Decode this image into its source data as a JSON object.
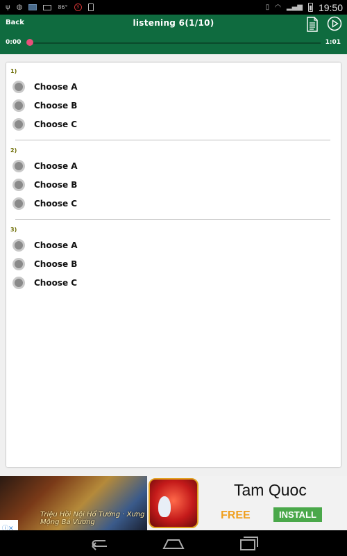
{
  "status_bar": {
    "temperature": "86°",
    "notification_count": "3",
    "time": "19:50"
  },
  "header": {
    "back_label": "Back",
    "title": "listening 6(1/10)",
    "time_current": "0:00",
    "time_total": "1:01",
    "progress_fraction": 0.0,
    "accent_color": "#0f6b3f",
    "seek_color": "#e8507a"
  },
  "questions": [
    {
      "number": "1)",
      "options": [
        "Choose A",
        "Choose B",
        "Choose C"
      ]
    },
    {
      "number": "2)",
      "options": [
        "Choose A",
        "Choose B",
        "Choose C"
      ]
    },
    {
      "number": "3)",
      "options": [
        "Choose A",
        "Choose B",
        "Choose C"
      ]
    }
  ],
  "ad": {
    "title": "Tam Quoc",
    "free_label": "FREE",
    "install_label": "INSTALL",
    "image_caption": "Triệu Hồi Nội Hổ Tướng · Xưng Mộng Bá Vương"
  },
  "icons": {
    "usb": "usb-icon",
    "doc": "document-icon",
    "play": "play-icon",
    "back": "nav-back-icon",
    "home": "nav-home-icon",
    "recents": "nav-recents-icon"
  }
}
